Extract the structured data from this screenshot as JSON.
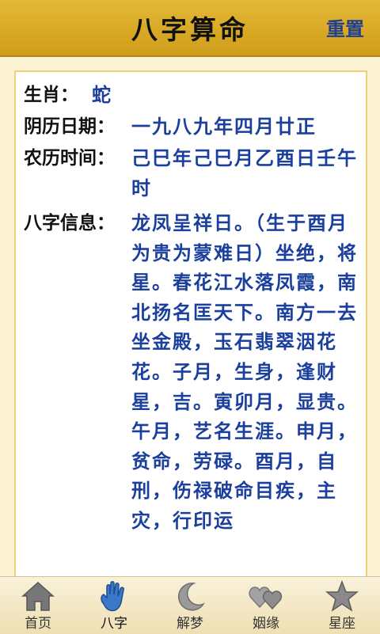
{
  "header": {
    "title": "八字算命",
    "reset_label": "重置"
  },
  "info": {
    "zodiac_label": "生肖：",
    "zodiac_value": "蛇",
    "lunar_date_label": "阴历日期：",
    "lunar_date_value": "一九八九年四月廿正",
    "lunar_time_label": "农历时间：",
    "lunar_time_value": "己巳年己巳月乙酉日壬午时",
    "bazi_label": "八字信息：",
    "bazi_value": "龙凤呈祥日。（生于酉月为贵为蒙难日）坐绝，将星。春花江水落凤霞，南北扬名匡天下。南方一去坐金殿，玉石翡翠洇花花。子月，生身，逢财星，吉。寅卯月，显贵。午月，艺名生涯。申月，贫命，劳碌。酉月，自刑，伤禄破命目疾，主灾，行印运"
  },
  "tabs": [
    {
      "label": "首页",
      "icon": "home-icon"
    },
    {
      "label": "八字",
      "icon": "hand-icon"
    },
    {
      "label": "解梦",
      "icon": "moon-icon"
    },
    {
      "label": "姻缘",
      "icon": "hearts-icon"
    },
    {
      "label": "星座",
      "icon": "star-icon"
    }
  ],
  "active_tab": "八字",
  "colors": {
    "header_bg": "#d8a824",
    "value_text": "#1b3f9c",
    "page_bg": "#fbf3d4"
  }
}
